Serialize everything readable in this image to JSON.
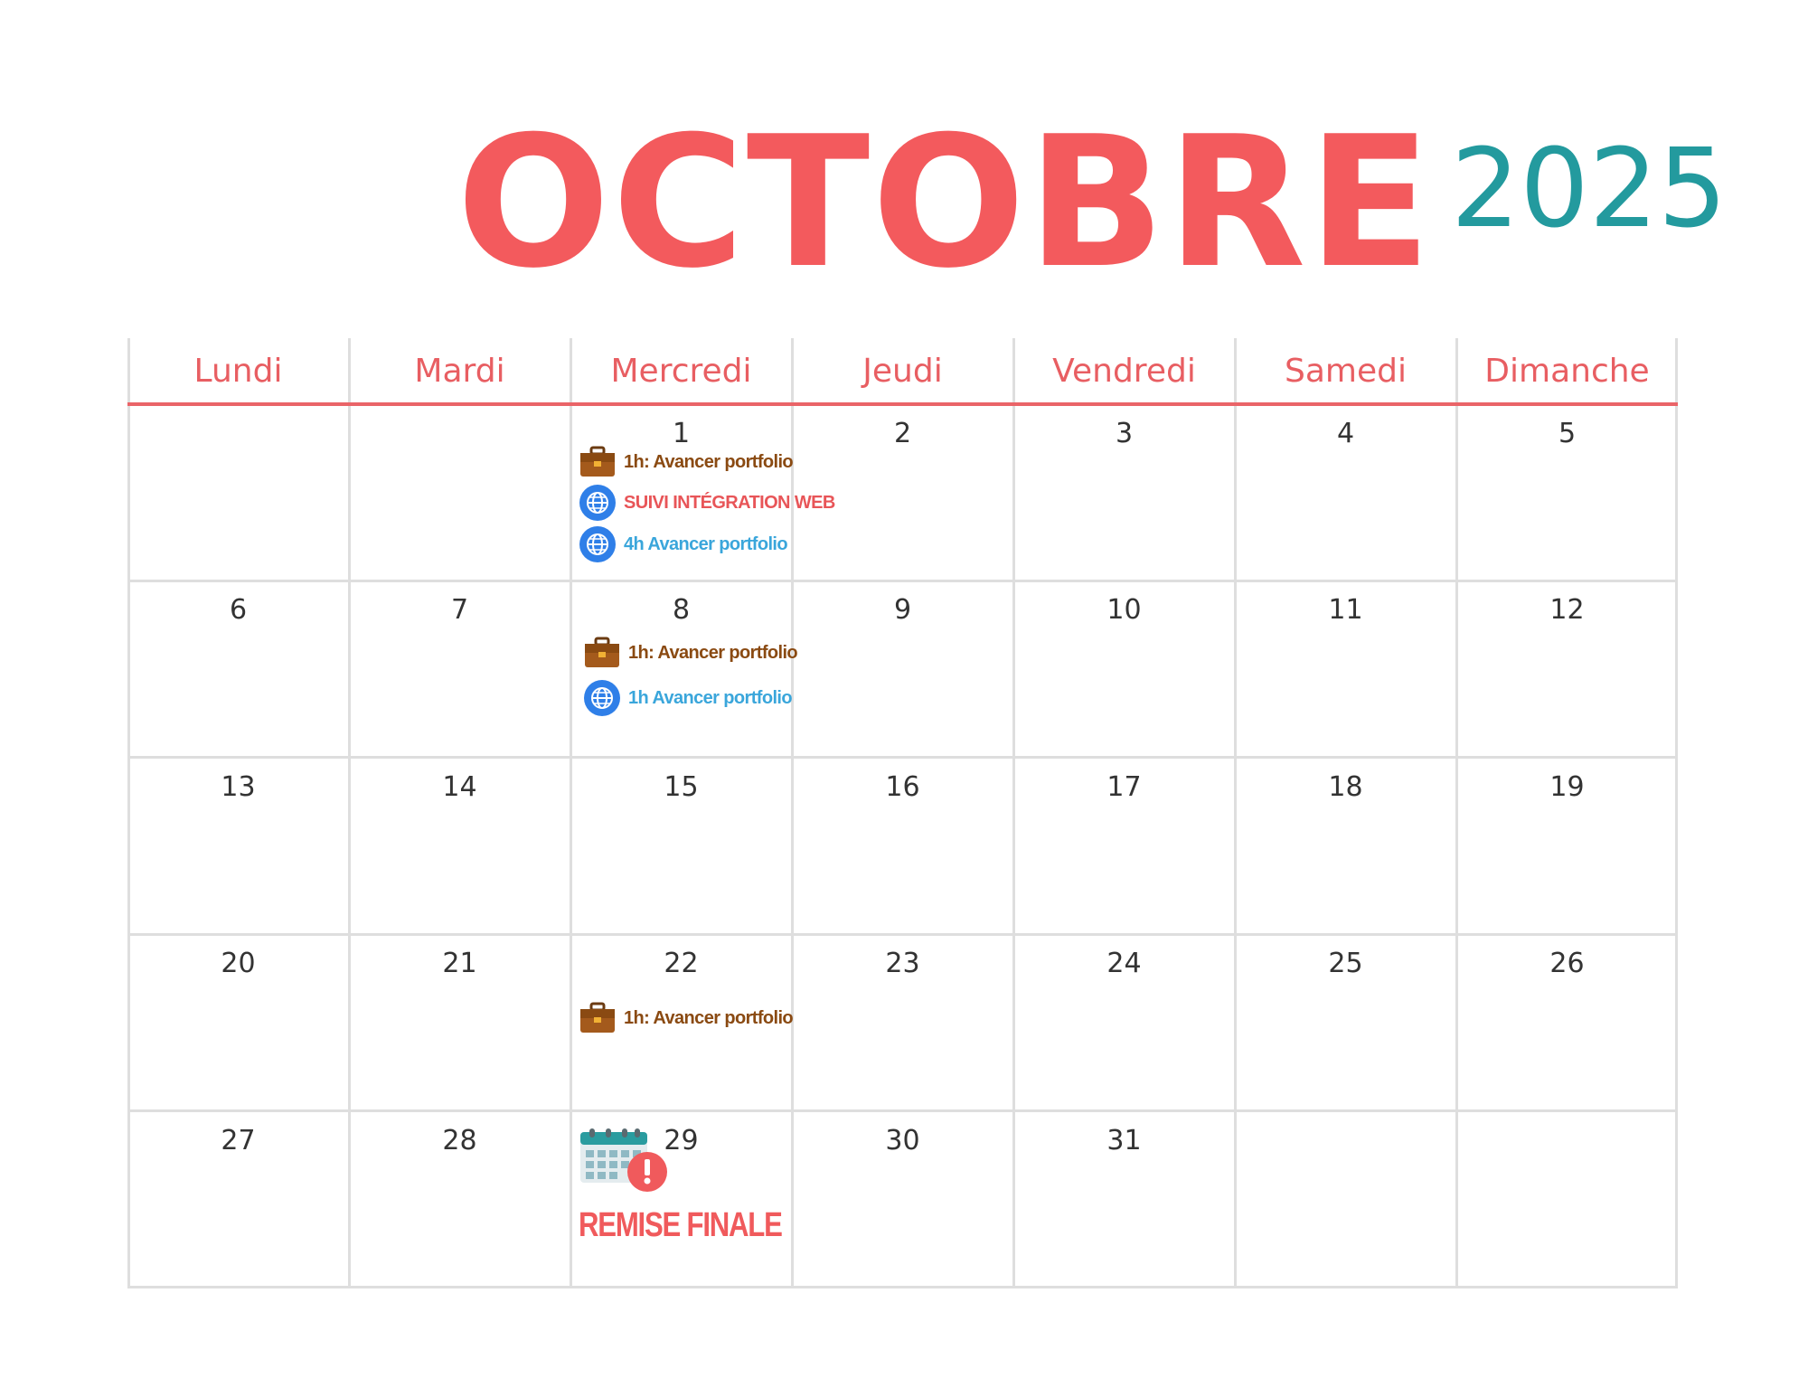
{
  "header": {
    "month": "OCTOBRE",
    "year": "2025"
  },
  "weekdays": [
    "Lundi",
    "Mardi",
    "Mercredi",
    "Jeudi",
    "Vendredi",
    "Samedi",
    "Dimanche"
  ],
  "weeks": [
    [
      "",
      "",
      "1",
      "2",
      "3",
      "4",
      "5"
    ],
    [
      "6",
      "7",
      "8",
      "9",
      "10",
      "11",
      "12"
    ],
    [
      "13",
      "14",
      "15",
      "16",
      "17",
      "18",
      "19"
    ],
    [
      "20",
      "21",
      "22",
      "23",
      "24",
      "25",
      "26"
    ],
    [
      "27",
      "28",
      "29",
      "30",
      "31",
      "",
      ""
    ]
  ],
  "events": {
    "oct1": [
      {
        "icon": "briefcase-icon",
        "label": "1h: Avancer portfolio",
        "color": "#8a4a12"
      },
      {
        "icon": "globe-icon",
        "label": "SUIVI INTÉGRATION WEB",
        "color": "#e85558"
      },
      {
        "icon": "globe-icon",
        "label": "4h Avancer portfolio",
        "color": "#3aa6db"
      }
    ],
    "oct8": [
      {
        "icon": "briefcase-icon",
        "label": "1h: Avancer portfolio",
        "color": "#8a4a12"
      },
      {
        "icon": "globe-icon",
        "label": "1h Avancer portfolio",
        "color": "#3aa6db"
      }
    ],
    "oct22": [
      {
        "icon": "briefcase-icon",
        "label": "1h: Avancer portfolio",
        "color": "#8a4a12"
      }
    ],
    "oct29": {
      "icon": "calendar-alert-icon",
      "label": "REMISE FINALE",
      "color": "#f05a5c"
    }
  },
  "colors": {
    "month": "#f35a5d",
    "year": "#239a9e",
    "weekday": "#e85e62",
    "grid": "#dedede",
    "day_number": "#333333"
  }
}
